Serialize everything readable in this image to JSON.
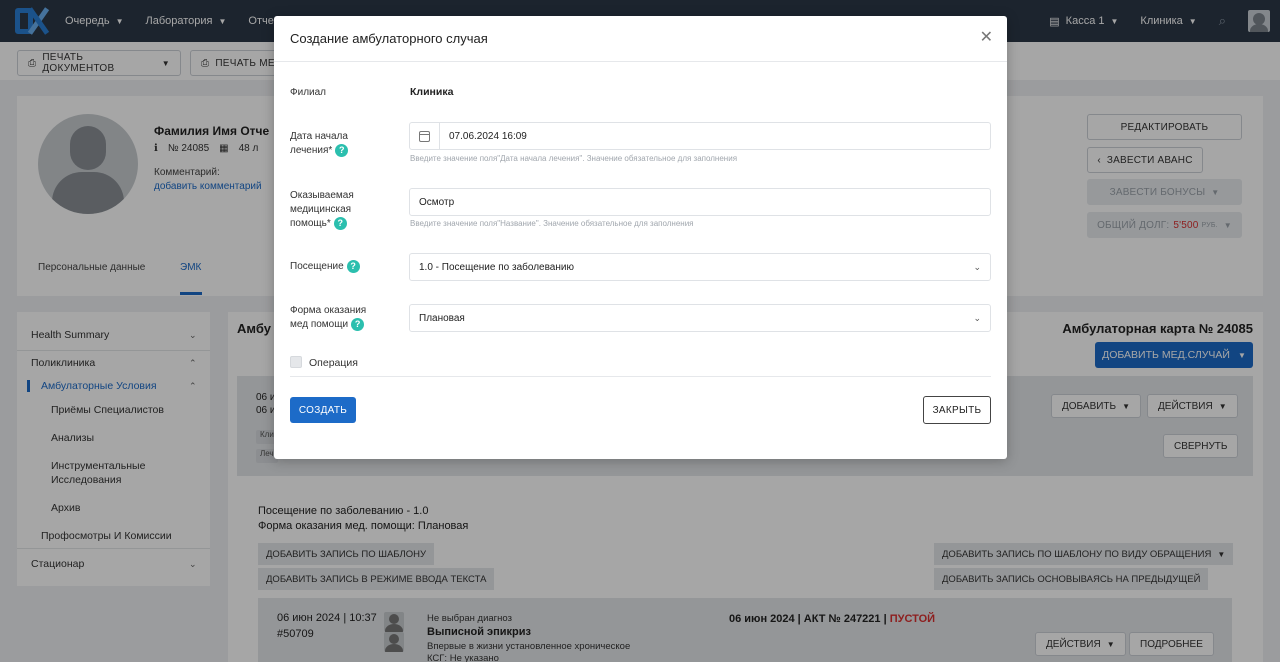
{
  "topbar": {
    "nav": [
      {
        "label": "Очередь"
      },
      {
        "label": "Лаборатория"
      },
      {
        "label": "Отче"
      }
    ],
    "cashbox": "Касса 1",
    "clinic": "Клиника"
  },
  "toolbar": {
    "print_docs": "ПЕЧАТЬ ДОКУМЕНТОВ",
    "print_second": "ПЕЧАТЬ МЕ"
  },
  "patient": {
    "name": "Фамилия Имя Отче",
    "number": "№ 24085",
    "age": "48 л",
    "comment_label": "Комментарий:",
    "comment_link": "добавить комментарий",
    "tabs": [
      "Персональные данные",
      "ЭМК"
    ],
    "buttons": {
      "edit": "РЕДАКТИРОВАТЬ",
      "advance": "ЗАВЕСТИ АВАНС",
      "bonus": "ЗАВЕСТИ БОНУСЫ",
      "debt_label": "ОБЩИЙ ДОЛГ:",
      "debt_value": "5'500",
      "debt_unit": "РУБ."
    }
  },
  "sidebar": {
    "items": [
      {
        "label": "Health Summary"
      },
      {
        "label": "Поликлиника"
      },
      {
        "label": "Амбулаторные Условия"
      },
      {
        "label": "Приёмы Специалистов"
      },
      {
        "label": "Анализы"
      },
      {
        "label": "Инструментальные"
      },
      {
        "label": "Исследования"
      },
      {
        "label": "Архив"
      },
      {
        "label": "Профосмотры И Комиссии"
      },
      {
        "label": "Стационар"
      }
    ]
  },
  "main": {
    "title_left": "Амбу",
    "title_right": "Амбулаторная карта № 24085",
    "add_case": "ДОБАВИТЬ МЕД.СЛУЧАЙ",
    "case": {
      "line1": "06 и",
      "line2": "06 и",
      "chip1": "Кли",
      "chip2": "Леч",
      "add": "ДОБАВИТЬ",
      "actions": "ДЕЙСТВИЯ",
      "collapse": "СВЕРНУТЬ"
    },
    "visit": "Посещение по заболеванию - 1.0",
    "form": "Форма оказания мед. помощи: Плановая",
    "record_buttons": {
      "by_template": "ДОБАВИТЬ ЗАПИСЬ ПО ШАБЛОНУ",
      "text_mode": "ДОБАВИТЬ ЗАПИСЬ В РЕЖИМЕ ВВОДА ТЕКСТА",
      "by_type": "ДОБАВИТЬ ЗАПИСЬ ПО ШАБЛОНУ ПО ВИДУ ОБРАЩЕНИЯ",
      "based_prev": "ДОБАВИТЬ ЗАПИСЬ ОСНОВЫВАЯСЬ НА ПРЕДЫДУЩЕЙ"
    },
    "entry": {
      "date": "06 июн 2024 | 10:37",
      "number": "#50709",
      "diag": "Не выбран диагноз",
      "title": "Выписной эпикриз",
      "sub": "Впервые в жизни установленное хроническое",
      "ksg": "КСГ: Не указано",
      "act": "06 июн 2024 | АКТ № 247221 |",
      "act_status": "ПУСТОЙ",
      "actions": "ДЕЙСТВИЯ",
      "more": "ПОДРОБНЕЕ"
    }
  },
  "modal": {
    "title": "Создание амбулаторного случая",
    "fields": {
      "branch_label": "Филиал",
      "branch_value": "Клиника",
      "start_label_1": "Дата начала",
      "start_label_2": "лечения*",
      "start_value": "07.06.2024 16:09",
      "start_hint": "Введите значение поля\"Дата начала лечения\". Значение обязательное для заполнения",
      "care_label_1": "Оказываемая",
      "care_label_2": "медицинская",
      "care_label_3": "помощь*",
      "care_value": "Осмотр",
      "care_hint": "Введите значение поля\"Название\". Значение обязательное для заполнения",
      "visit_label": "Посещение",
      "visit_value": "1.0 - Посещение по заболеванию",
      "form_label_1": "Форма оказания",
      "form_label_2": "мед помощи",
      "form_value": "Плановая",
      "operation_label": "Операция"
    },
    "create": "СОЗДАТЬ",
    "close": "ЗАКРЫТЬ"
  }
}
